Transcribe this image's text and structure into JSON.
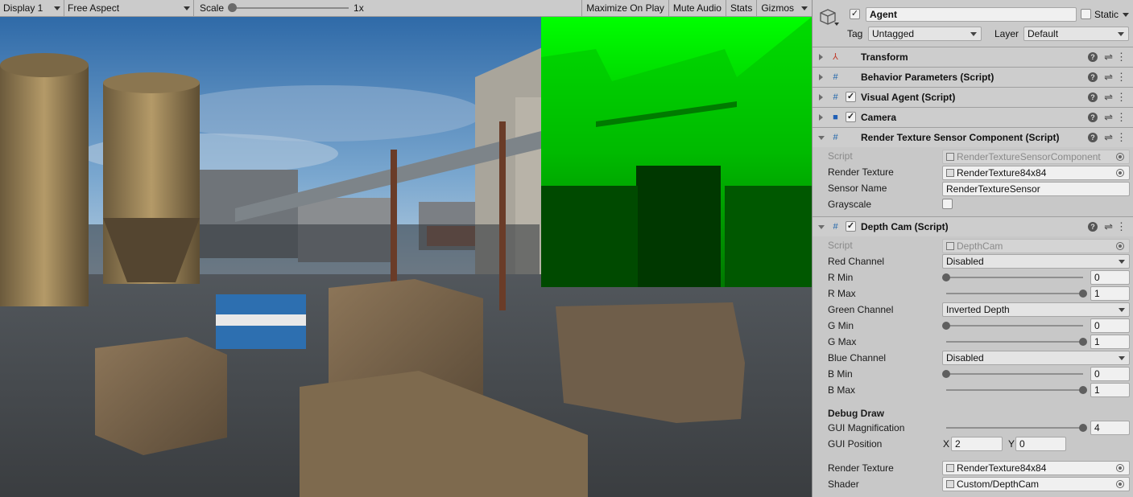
{
  "game_toolbar": {
    "display": "Display 1",
    "aspect": "Free Aspect",
    "scale_label": "Scale",
    "scale_value": "1x",
    "maximize": "Maximize On Play",
    "mute": "Mute Audio",
    "stats": "Stats",
    "gizmos": "Gizmos"
  },
  "inspector": {
    "object_name": "Agent",
    "static_label": "Static",
    "tag_label": "Tag",
    "tag_value": "Untagged",
    "layer_label": "Layer",
    "layer_value": "Default",
    "components": [
      {
        "title": "Transform"
      },
      {
        "title": "Behavior Parameters (Script)"
      },
      {
        "title": "Visual Agent (Script)"
      },
      {
        "title": "Camera"
      },
      {
        "title": "Render Texture Sensor Component (Script)"
      },
      {
        "title": "Depth Cam (Script)"
      }
    ],
    "rtsc": {
      "script_label": "Script",
      "script_value": "RenderTextureSensorComponent",
      "render_texture_label": "Render Texture",
      "render_texture_value": "RenderTexture84x84",
      "sensor_name_label": "Sensor Name",
      "sensor_name_value": "RenderTextureSensor",
      "grayscale_label": "Grayscale"
    },
    "depthcam": {
      "script_label": "Script",
      "script_value": "DepthCam",
      "red_channel_label": "Red Channel",
      "red_channel_value": "Disabled",
      "r_min_label": "R Min",
      "r_min_value": "0",
      "r_min_level": 0,
      "r_max_label": "R Max",
      "r_max_value": "1",
      "r_max_level": 1,
      "green_channel_label": "Green Channel",
      "green_channel_value": "Inverted Depth",
      "g_min_label": "G Min",
      "g_min_value": "0",
      "g_min_level": 0,
      "g_max_label": "G Max",
      "g_max_value": "1",
      "g_max_level": 1,
      "blue_channel_label": "Blue Channel",
      "blue_channel_value": "Disabled",
      "b_min_label": "B Min",
      "b_min_value": "0",
      "b_min_level": 0,
      "b_max_label": "B Max",
      "b_max_value": "1",
      "b_max_level": 1,
      "debug_draw_label": "Debug Draw",
      "gui_mag_label": "GUI Magnification",
      "gui_mag_value": "4",
      "gui_mag_level": 1,
      "gui_pos_label": "GUI Position",
      "gui_pos_x_label": "X",
      "gui_pos_x_value": "2",
      "gui_pos_y_label": "Y",
      "gui_pos_y_value": "0",
      "render_texture_label": "Render Texture",
      "render_texture_value": "RenderTexture84x84",
      "shader_label": "Shader",
      "shader_value": "Custom/DepthCam"
    },
    "colors": {
      "depth_overlay": "#00ff00",
      "sky": "#3f78b5",
      "inspector_bg": "#c8c8c8"
    }
  }
}
